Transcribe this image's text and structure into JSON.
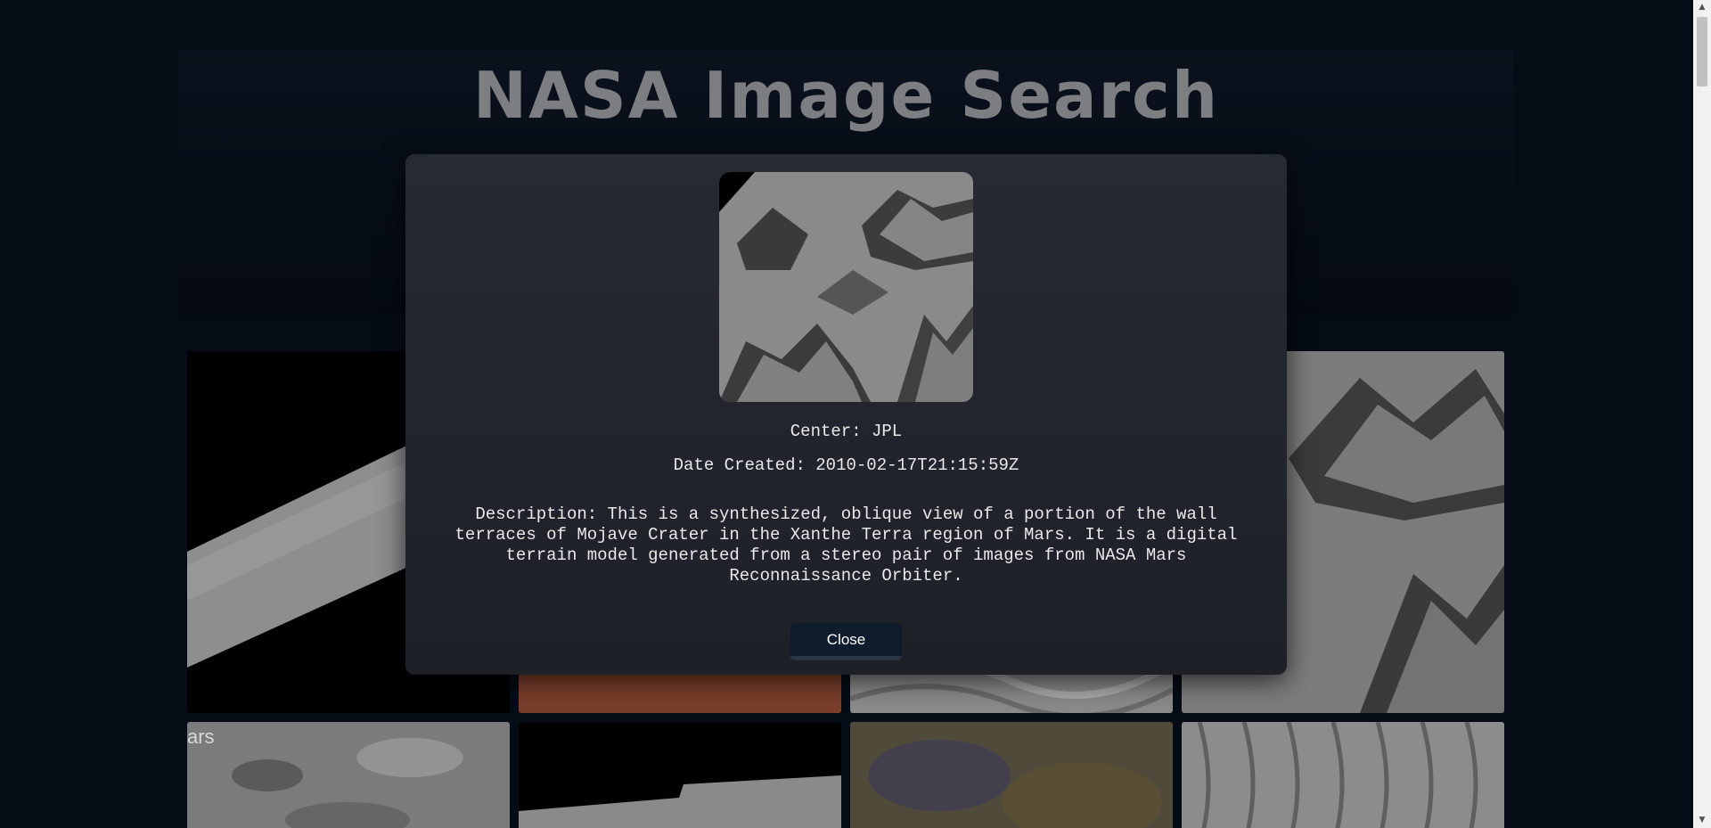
{
  "header": {
    "title": "NASA Image Search"
  },
  "gallery": {
    "cards": [
      {
        "name": "mars-rock-strip"
      },
      {
        "name": "mars-red-surface"
      },
      {
        "name": "mars-dunes"
      },
      {
        "name": "mojave-crater-terrain"
      },
      {
        "name": "mars-cratered-surface",
        "caption": "ars"
      },
      {
        "name": "mars-black-strip"
      },
      {
        "name": "mars-color-terrain"
      },
      {
        "name": "mars-ripple-dunes"
      }
    ]
  },
  "modal": {
    "center": "Center: JPL",
    "date_created": "Date Created: 2010-02-17T21:15:59Z",
    "description": "Description: This is a synthesized, oblique view of a portion of the wall terraces of Mojave Crater in the Xanthe Terra region of Mars. It is a digital terrain model generated from a stereo pair of images from NASA Mars Reconnaissance Orbiter.",
    "close_label": "Close"
  },
  "colors": {
    "background": "#060c15",
    "modal_bg": "#23262e",
    "button_bg": "#0f1c2e",
    "title": "#7c7e81"
  }
}
